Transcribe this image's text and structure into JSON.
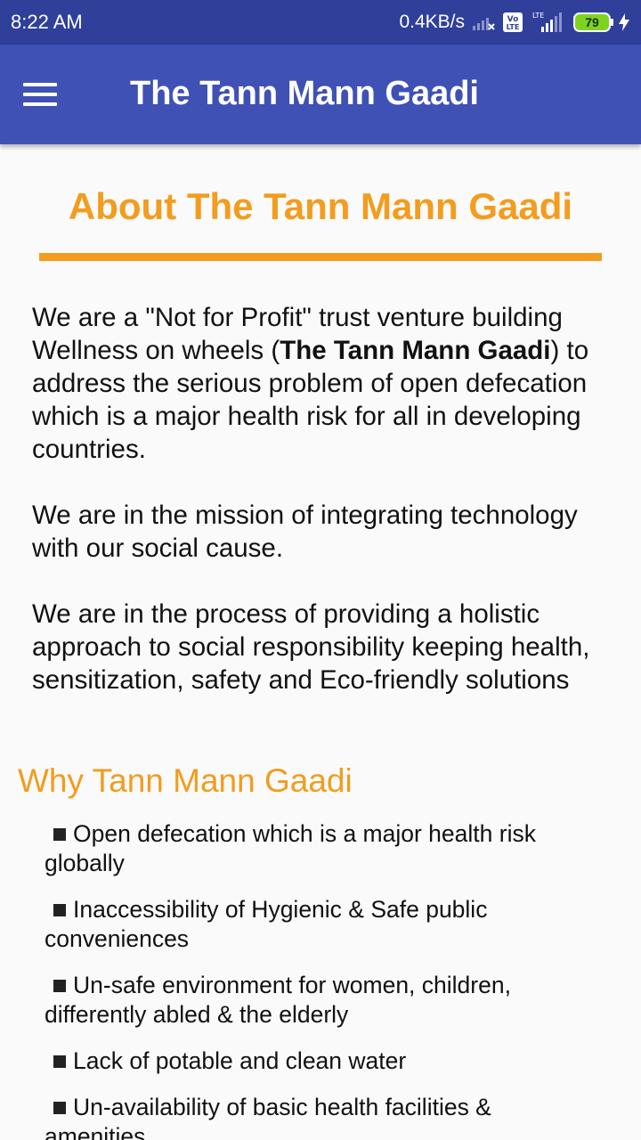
{
  "status_bar": {
    "time": "8:22 AM",
    "net_speed": "0.4KB/s",
    "volte_label": "Vo LTE",
    "lte_label": "LTE",
    "battery_level": "79",
    "icons": [
      "signal-bars-icon",
      "volte-icon",
      "lte-signal-icon",
      "battery-icon",
      "charging-bolt-icon"
    ]
  },
  "app_bar": {
    "title": "The Tann Mann Gaadi",
    "menu_icon": "hamburger-menu-icon"
  },
  "about": {
    "heading": "About The Tann Mann Gaadi",
    "para1_before": "We are a \"Not for Profit\" trust venture building Wellness on wheels (",
    "para1_bold": "The Tann Mann Gaadi",
    "para1_after": ") to address the serious problem of open defecation which is a major health risk for all in developing countries.",
    "para2": "We are in the mission of integrating technology with our social cause.",
    "para3": "We are in the process of providing a holistic approach to social responsibility keeping health, sensitization, safety and Eco-friendly solutions"
  },
  "why": {
    "heading": "Why Tann Mann Gaadi",
    "items": [
      "Open defecation which is a major health risk globally",
      "Inaccessibility of Hygienic & Safe public conveniences",
      "Un-safe environment for women, children, differently abled & the elderly",
      "Lack of potable and  clean water",
      "Un-availability of basic health facilities & amenities"
    ]
  },
  "colors": {
    "status_bar": "#2f3f9a",
    "app_bar": "#3f51b5",
    "accent": "#f39c1e",
    "background": "#fafafa",
    "text": "#111111"
  }
}
